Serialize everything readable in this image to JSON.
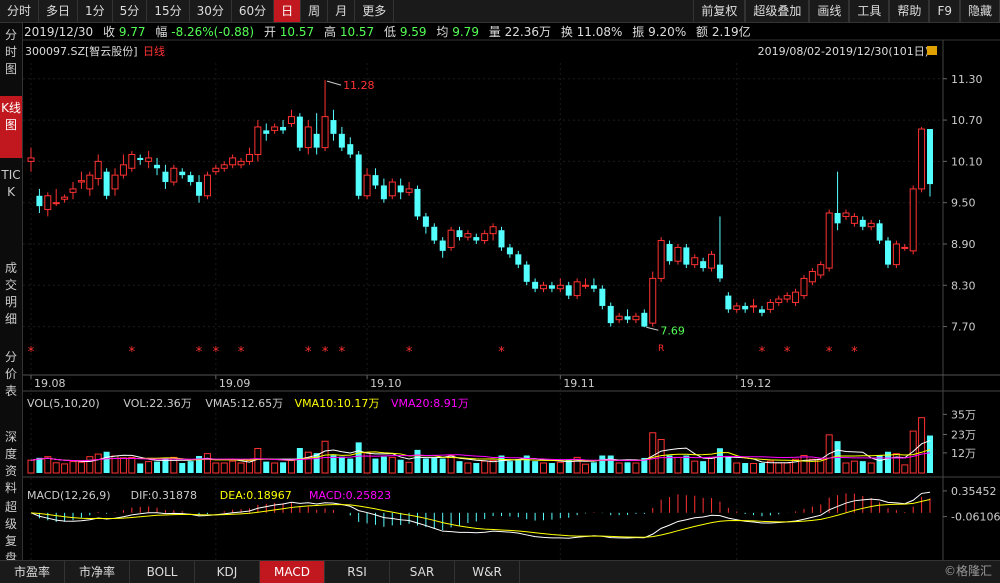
{
  "toolbar": {
    "tabs": [
      {
        "label": "分时",
        "active": false
      },
      {
        "label": "多日",
        "active": false
      },
      {
        "label": "1分",
        "active": false
      },
      {
        "label": "5分",
        "active": false
      },
      {
        "label": "15分",
        "active": false
      },
      {
        "label": "30分",
        "active": false
      },
      {
        "label": "60分",
        "active": false
      },
      {
        "label": "日",
        "active": true
      },
      {
        "label": "周",
        "active": false
      },
      {
        "label": "月",
        "active": false
      },
      {
        "label": "更多",
        "active": false
      }
    ],
    "right_tabs": [
      "前复权",
      "超级叠加",
      "画线",
      "工具",
      "帮助",
      "F9",
      "隐藏"
    ]
  },
  "info": {
    "date": "2019/12/30",
    "close_label": "收",
    "close": "9.77",
    "change_label": "幅",
    "change": "-8.26%(-0.88)",
    "open_label": "开",
    "open": "10.57",
    "high_label": "高",
    "high": "10.57",
    "low_label": "低",
    "low": "9.59",
    "avg_label": "均",
    "avg": "9.79",
    "volume_label": "量",
    "volume": "22.36万",
    "turnover_label": "换",
    "turnover": "11.08%",
    "amplitude_label": "振",
    "amplitude": "9.20%",
    "amount_label": "额",
    "amount": "2.19亿"
  },
  "stock": {
    "code": "300097.SZ",
    "name": "[智云股份]",
    "period": "日线",
    "range": "2019/08/02-2019/12/30(101日)"
  },
  "sidebar": [
    {
      "label": "分时图",
      "active": false
    },
    {
      "label": "K线图",
      "active": true
    },
    {
      "label": "TICK",
      "active": false
    },
    {
      "label": "成交明细",
      "active": false
    },
    {
      "label": "分价表",
      "active": false
    },
    {
      "label": "深度资料",
      "active": false
    },
    {
      "label": "超级复盘",
      "active": false
    }
  ],
  "price_axis": {
    "ticks": [
      11.3,
      10.7,
      10.1,
      9.5,
      8.9,
      8.3,
      7.7
    ],
    "tick_labels": [
      "11.30",
      "10.70",
      "10.10",
      "9.50",
      "8.90",
      "8.30",
      "7.70"
    ],
    "min": 7.2,
    "max": 11.5
  },
  "date_axis": {
    "labels": [
      "19.08",
      "19.09",
      "19.10",
      "19.11",
      "19.12"
    ],
    "label_index": [
      0,
      22,
      40,
      63,
      84
    ]
  },
  "annotations": {
    "high": "11.28",
    "low": "7.69",
    "r_mark": "R"
  },
  "candles": [
    [
      10.1,
      10.15,
      9.95,
      10.3
    ],
    [
      9.6,
      9.45,
      9.35,
      9.7
    ],
    [
      9.4,
      9.6,
      9.3,
      9.65
    ],
    [
      9.5,
      9.5,
      9.45,
      9.7
    ],
    [
      9.55,
      9.58,
      9.5,
      9.62
    ],
    [
      9.65,
      9.7,
      9.55,
      9.8
    ],
    [
      9.8,
      9.82,
      9.7,
      9.95
    ],
    [
      9.7,
      9.9,
      9.6,
      9.95
    ],
    [
      9.85,
      10.1,
      9.75,
      10.2
    ],
    [
      9.95,
      9.6,
      9.55,
      10.0
    ],
    [
      9.7,
      9.9,
      9.6,
      10.0
    ],
    [
      9.9,
      10.05,
      9.85,
      10.2
    ],
    [
      10.0,
      10.2,
      9.95,
      10.25
    ],
    [
      10.15,
      10.12,
      10.05,
      10.2
    ],
    [
      10.1,
      10.15,
      10.0,
      10.25
    ],
    [
      10.05,
      10.0,
      9.9,
      10.15
    ],
    [
      9.95,
      9.8,
      9.7,
      10.05
    ],
    [
      9.8,
      10.0,
      9.75,
      10.05
    ],
    [
      9.95,
      9.9,
      9.85,
      10.0
    ],
    [
      9.9,
      9.8,
      9.75,
      9.95
    ],
    [
      9.8,
      9.6,
      9.5,
      9.9
    ],
    [
      9.6,
      9.9,
      9.55,
      9.95
    ],
    [
      9.95,
      10.0,
      9.9,
      10.05
    ],
    [
      10.0,
      10.05,
      9.95,
      10.1
    ],
    [
      10.05,
      10.15,
      10.0,
      10.2
    ],
    [
      10.05,
      10.1,
      10.0,
      10.15
    ],
    [
      10.1,
      10.2,
      10.05,
      10.3
    ],
    [
      10.2,
      10.6,
      10.1,
      10.7
    ],
    [
      10.55,
      10.5,
      10.4,
      10.65
    ],
    [
      10.55,
      10.6,
      10.5,
      10.65
    ],
    [
      10.6,
      10.55,
      10.5,
      10.7
    ],
    [
      10.65,
      10.75,
      10.6,
      10.85
    ],
    [
      10.75,
      10.3,
      10.25,
      10.8
    ],
    [
      10.3,
      10.6,
      10.2,
      10.7
    ],
    [
      10.5,
      10.3,
      10.2,
      10.8
    ],
    [
      10.3,
      10.75,
      10.25,
      11.28
    ],
    [
      10.7,
      10.5,
      10.4,
      10.85
    ],
    [
      10.5,
      10.3,
      10.25,
      10.6
    ],
    [
      10.35,
      10.2,
      10.15,
      10.45
    ],
    [
      10.2,
      9.6,
      9.55,
      10.25
    ],
    [
      9.6,
      9.9,
      9.55,
      10.0
    ],
    [
      9.9,
      9.75,
      9.7,
      10.0
    ],
    [
      9.75,
      9.55,
      9.5,
      9.85
    ],
    [
      9.6,
      9.8,
      9.55,
      9.85
    ],
    [
      9.75,
      9.65,
      9.55,
      9.85
    ],
    [
      9.65,
      9.7,
      9.6,
      9.8
    ],
    [
      9.7,
      9.3,
      9.25,
      9.75
    ],
    [
      9.3,
      9.15,
      9.05,
      9.35
    ],
    [
      9.15,
      8.95,
      8.9,
      9.2
    ],
    [
      8.95,
      8.8,
      8.7,
      9.0
    ],
    [
      8.85,
      9.1,
      8.8,
      9.15
    ],
    [
      9.1,
      9.0,
      8.95,
      9.15
    ],
    [
      9.0,
      9.05,
      8.95,
      9.1
    ],
    [
      9.0,
      8.95,
      8.9,
      9.05
    ],
    [
      8.95,
      9.05,
      8.9,
      9.1
    ],
    [
      9.05,
      9.15,
      8.95,
      9.2
    ],
    [
      9.1,
      8.85,
      8.8,
      9.15
    ],
    [
      8.85,
      8.75,
      8.7,
      8.9
    ],
    [
      8.75,
      8.6,
      8.55,
      8.8
    ],
    [
      8.6,
      8.35,
      8.3,
      8.65
    ],
    [
      8.35,
      8.25,
      8.2,
      8.4
    ],
    [
      8.25,
      8.3,
      8.2,
      8.35
    ],
    [
      8.3,
      8.25,
      8.2,
      8.35
    ],
    [
      8.25,
      8.3,
      8.2,
      8.4
    ],
    [
      8.3,
      8.15,
      8.1,
      8.35
    ],
    [
      8.15,
      8.35,
      8.1,
      8.4
    ],
    [
      8.3,
      8.3,
      8.25,
      8.4
    ],
    [
      8.3,
      8.25,
      8.2,
      8.4
    ],
    [
      8.25,
      8.0,
      7.95,
      8.3
    ],
    [
      8.0,
      7.75,
      7.7,
      8.05
    ],
    [
      7.8,
      7.85,
      7.75,
      7.9
    ],
    [
      7.85,
      7.8,
      7.75,
      7.95
    ],
    [
      7.8,
      7.85,
      7.75,
      7.9
    ],
    [
      7.9,
      7.7,
      7.69,
      7.95
    ],
    [
      7.75,
      8.4,
      7.7,
      8.5
    ],
    [
      8.4,
      8.95,
      8.35,
      9.0
    ],
    [
      8.9,
      8.65,
      8.6,
      8.95
    ],
    [
      8.65,
      8.85,
      8.6,
      8.9
    ],
    [
      8.85,
      8.6,
      8.55,
      8.9
    ],
    [
      8.6,
      8.7,
      8.55,
      8.75
    ],
    [
      8.65,
      8.55,
      8.5,
      8.7
    ],
    [
      8.55,
      8.75,
      8.5,
      8.8
    ],
    [
      8.6,
      8.4,
      8.35,
      9.3
    ],
    [
      8.15,
      7.95,
      7.9,
      8.2
    ],
    [
      7.95,
      8.0,
      7.9,
      8.05
    ],
    [
      8.0,
      7.95,
      7.9,
      8.05
    ],
    [
      8.0,
      8.0,
      7.9,
      8.1
    ],
    [
      7.95,
      7.9,
      7.85,
      8.0
    ],
    [
      7.95,
      8.05,
      7.9,
      8.1
    ],
    [
      8.05,
      8.1,
      8.0,
      8.15
    ],
    [
      8.1,
      8.15,
      8.05,
      8.2
    ],
    [
      8.05,
      8.2,
      8.0,
      8.25
    ],
    [
      8.15,
      8.4,
      8.1,
      8.45
    ],
    [
      8.35,
      8.5,
      8.3,
      8.55
    ],
    [
      8.45,
      8.6,
      8.4,
      8.65
    ],
    [
      8.55,
      9.35,
      8.5,
      9.4
    ],
    [
      9.35,
      9.2,
      9.1,
      9.95
    ],
    [
      9.3,
      9.35,
      9.25,
      9.4
    ],
    [
      9.2,
      9.3,
      9.15,
      9.35
    ],
    [
      9.25,
      9.15,
      9.1,
      9.3
    ],
    [
      9.15,
      9.2,
      9.1,
      9.25
    ],
    [
      9.2,
      8.95,
      8.9,
      9.25
    ],
    [
      8.95,
      8.6,
      8.55,
      9.0
    ],
    [
      8.6,
      8.9,
      8.55,
      8.95
    ],
    [
      8.85,
      8.85,
      8.8,
      8.9
    ],
    [
      8.8,
      9.7,
      8.75,
      9.75
    ],
    [
      9.7,
      10.57,
      9.65,
      10.6
    ],
    [
      10.57,
      9.77,
      9.59,
      10.57
    ]
  ],
  "volume": {
    "title": "VOL(5,10,20)",
    "current_label": "VOL:22.36万",
    "ma5": "VMA5:12.65万",
    "ma10": "VMA10:10.17万",
    "ma20": "VMA20:8.91万",
    "tick_labels": [
      "35万",
      "23万",
      "12万"
    ],
    "ticks": [
      35,
      23,
      12
    ],
    "max": 37
  },
  "macd": {
    "title": "MACD(12,26,9)",
    "dif": "DIF:0.31878",
    "dea": "DEA:0.18967",
    "macd": "MACD:0.25823",
    "tick_labels": [
      "0.35452",
      "-0.06106"
    ],
    "ticks": [
      0.35452,
      -0.06106
    ],
    "min": -0.65,
    "max": 0.45
  },
  "bottom_tabs": [
    {
      "label": "市盈率",
      "active": false
    },
    {
      "label": "市净率",
      "active": false
    },
    {
      "label": "BOLL",
      "active": false
    },
    {
      "label": "KDJ",
      "active": false
    },
    {
      "label": "MACD",
      "active": true
    },
    {
      "label": "RSI",
      "active": false
    },
    {
      "label": "SAR",
      "active": false
    },
    {
      "label": "W&R",
      "active": false
    }
  ],
  "watermark": "©格隆汇",
  "colors": {
    "up": "#ff3232",
    "down": "#54ffff",
    "ma5": "#ffffff",
    "ma10": "#ffff00",
    "ma20": "#ff00ff",
    "star": "#ff3232",
    "accent": "#c0181e"
  }
}
